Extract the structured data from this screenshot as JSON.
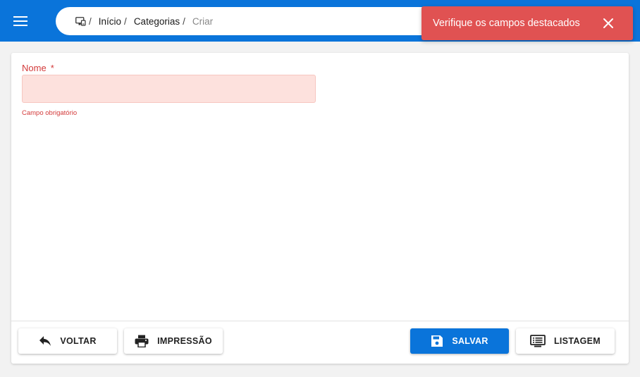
{
  "header": {
    "menu_icon": "menu-icon",
    "breadcrumb": {
      "home_icon": "app-home-icon",
      "home_sep": "/",
      "items": [
        {
          "label": "Início",
          "sep": "/"
        },
        {
          "label": "Categorias",
          "sep": "/"
        },
        {
          "label": "Criar"
        }
      ]
    }
  },
  "toast": {
    "message": "Verifique os campos destacados",
    "close_icon": "close-icon",
    "color": "#e05252"
  },
  "form": {
    "name_field": {
      "label": "Nome",
      "required_marker": "*",
      "value": "",
      "error": "Campo obrigatório"
    }
  },
  "actions": {
    "back": {
      "label": "VOLTAR",
      "icon": "reply-icon"
    },
    "print": {
      "label": "IMPRESSÃO",
      "icon": "printer-icon"
    },
    "save": {
      "label": "SALVAR",
      "icon": "save-icon"
    },
    "list": {
      "label": "LISTAGEM",
      "icon": "list-icon"
    }
  },
  "colors": {
    "primary": "#0a74da",
    "error": "#d33a3a",
    "error_bg": "#fde1dd"
  }
}
